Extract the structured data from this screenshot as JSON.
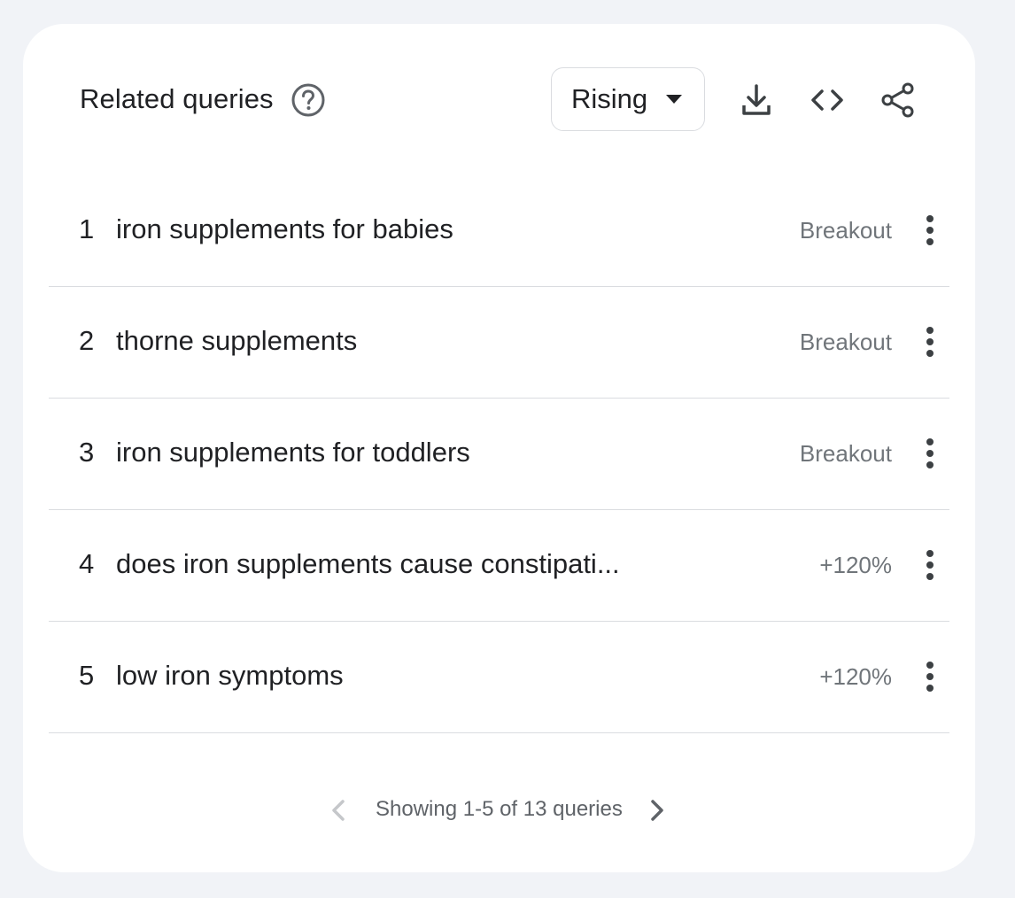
{
  "widget": {
    "title": "Related queries",
    "filter": {
      "selected": "Rising"
    },
    "icons": {
      "help": "help-circle-icon",
      "download": "download-icon",
      "embed": "code-embed-icon",
      "share": "share-icon",
      "more": "more-vert-icon"
    },
    "queries": [
      {
        "rank": "1",
        "query": "iron supplements for babies",
        "value": "Breakout"
      },
      {
        "rank": "2",
        "query": "thorne supplements",
        "value": "Breakout"
      },
      {
        "rank": "3",
        "query": "iron supplements for toddlers",
        "value": "Breakout"
      },
      {
        "rank": "4",
        "query": "does iron supplements cause constipati...",
        "value": "+120%"
      },
      {
        "rank": "5",
        "query": "low iron symptoms",
        "value": "+120%"
      }
    ],
    "pagination": {
      "text": "Showing 1-5 of 13 queries"
    }
  },
  "colors": {
    "page_background": "#f1f3f7",
    "card_background": "#ffffff",
    "text_primary": "#202124",
    "text_secondary": "#70757a",
    "divider": "#dadce0",
    "icon": "#5f6368",
    "disabled_icon": "#c5c7ca"
  }
}
